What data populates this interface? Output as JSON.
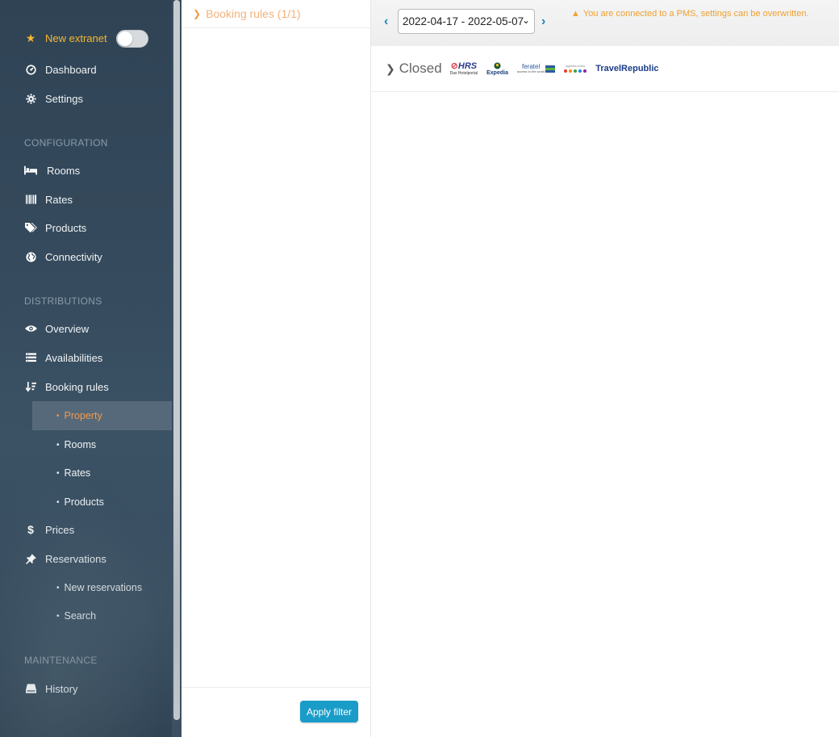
{
  "sidebar": {
    "extranet": {
      "label": "New extranet",
      "toggle_on": false
    },
    "top_items": [
      {
        "label": "Dashboard",
        "icon": "dashboard-icon"
      },
      {
        "label": "Settings",
        "icon": "gear-icon"
      }
    ],
    "configuration": {
      "title": "CONFIGURATION",
      "items": [
        {
          "label": "Rooms",
          "icon": "bed-icon"
        },
        {
          "label": "Rates",
          "icon": "barcode-icon"
        },
        {
          "label": "Products",
          "icon": "tags-icon"
        },
        {
          "label": "Connectivity",
          "icon": "globe-icon"
        }
      ]
    },
    "distributions": {
      "title": "DISTRIBUTIONS",
      "items": [
        {
          "label": "Overview",
          "icon": "eye-icon"
        },
        {
          "label": "Availabilities",
          "icon": "list-icon"
        },
        {
          "label": "Booking rules",
          "icon": "sort-icon"
        }
      ],
      "booking_rules_sub": [
        {
          "label": "Property",
          "active": true
        },
        {
          "label": "Rooms",
          "active": false
        },
        {
          "label": "Rates",
          "active": false
        },
        {
          "label": "Products",
          "active": false
        }
      ],
      "after_items": [
        {
          "label": "Prices",
          "icon": "dollar-icon"
        },
        {
          "label": "Reservations",
          "icon": "pin-icon"
        }
      ],
      "reservations_sub": [
        {
          "label": "New reservations"
        },
        {
          "label": "Search"
        }
      ]
    },
    "maintenance": {
      "title": "MAINTENANCE",
      "items": [
        {
          "label": "History",
          "icon": "inbox-icon"
        }
      ]
    }
  },
  "middle": {
    "header": "Booking rules (1/1)",
    "apply_button": "Apply filter"
  },
  "main": {
    "date_range": "2022-04-17 - 2022-05-07",
    "pms_warning": "You are connected to a PMS, settings can be overwritten.",
    "closed_label": "Closed",
    "channels": [
      {
        "name": "HRS",
        "sub": "Das Hotelportal"
      },
      {
        "name": "Expedia"
      },
      {
        "name": "feratel",
        "sub": "access to the world"
      },
      {
        "name": "agenda",
        "sub": "agenda.coms"
      },
      {
        "name": "Travel",
        "name2": "Republic"
      }
    ]
  },
  "colors": {
    "accent_orange": "#f39a4a",
    "warning": "#f0a030",
    "apply_button": "#1a9cc8",
    "extranet_yellow": "#f5b731"
  }
}
